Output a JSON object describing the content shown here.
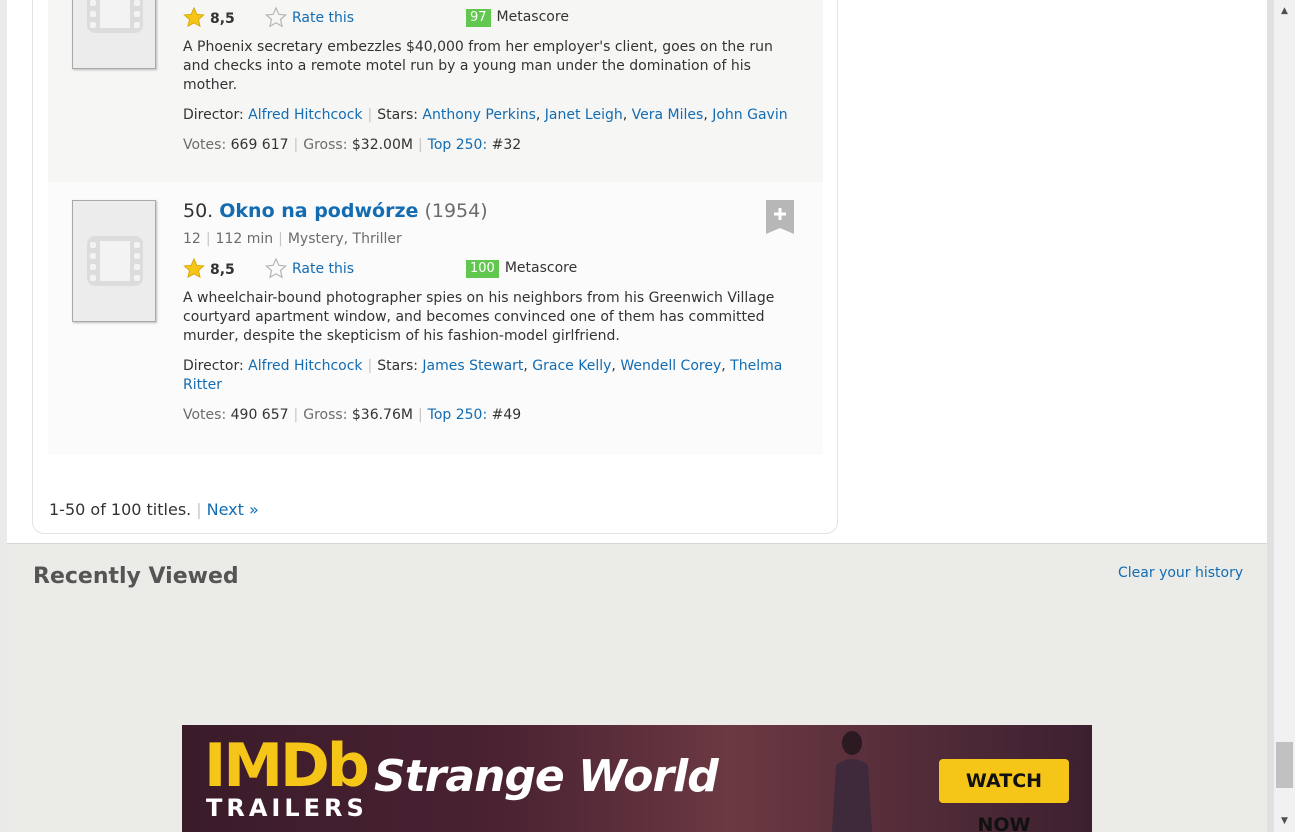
{
  "items": [
    {
      "rating": "8,5",
      "rate_label": "Rate this",
      "metascore": "97",
      "metascore_label": "Metascore",
      "description": "A Phoenix secretary embezzles $40,000 from her employer's client, goes on the run and checks into a remote motel run by a young man under the domination of his mother.",
      "director_label": "Director:",
      "director": "Alfred Hitchcock",
      "stars_label": "Stars:",
      "stars": [
        "Anthony Perkins",
        "Janet Leigh",
        "Vera Miles",
        "John Gavin"
      ],
      "votes_label": "Votes:",
      "votes": "669 617",
      "gross_label": "Gross:",
      "gross": "$32.00M",
      "top_label": "Top 250:",
      "top_rank": "#32"
    },
    {
      "number": "50.",
      "title": "Okno na podwórze",
      "year": "(1954)",
      "certificate": "12",
      "runtime": "112 min",
      "genre": "Mystery, Thriller",
      "rating": "8,5",
      "rate_label": "Rate this",
      "metascore": "100",
      "metascore_label": "Metascore",
      "description": "A wheelchair-bound photographer spies on his neighbors from his Greenwich Village courtyard apartment window, and becomes convinced one of them has committed murder, despite the skepticism of his fashion-model girlfriend.",
      "director_label": "Director:",
      "director": "Alfred Hitchcock",
      "stars_label": "Stars:",
      "stars": [
        "James Stewart",
        "Grace Kelly",
        "Wendell Corey",
        "Thelma Ritter"
      ],
      "votes_label": "Votes:",
      "votes": "490 657",
      "gross_label": "Gross:",
      "gross": "$36.76M",
      "top_label": "Top 250:",
      "top_rank": "#49"
    }
  ],
  "pagination": {
    "range": "1-50 of 100 titles.",
    "next": "Next »"
  },
  "recently_viewed": {
    "title": "Recently Viewed",
    "clear": "Clear your history"
  },
  "banner": {
    "logo_top": "IMDb",
    "logo_bottom": "TRAILERS",
    "movie": "Strange World",
    "cta": "WATCH NOW"
  },
  "colors": {
    "link": "#136cb2",
    "metascore_green": "#61c74f",
    "star_gold": "#f5c518"
  }
}
